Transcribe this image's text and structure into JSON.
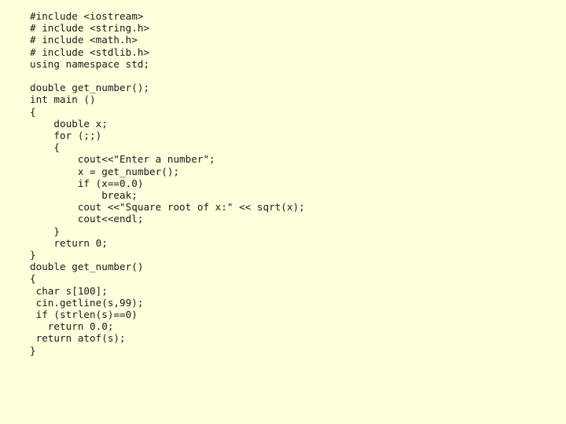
{
  "slide": {
    "background_color": "#ffffdc",
    "text_color": "#181818",
    "language": "cpp",
    "code_lines": [
      "#include <iostream>",
      "# include <string.h>",
      "# include <math.h>",
      "# include <stdlib.h>",
      "using namespace std;",
      "",
      "double get_number();",
      "int main ()",
      "{",
      "    double x;",
      "    for (;;)",
      "    {",
      "        cout<<\"Enter a number\";",
      "        x = get_number();",
      "        if (x==0.0)",
      "            break;",
      "        cout <<\"Square root of x:\" << sqrt(x);",
      "        cout<<endl;",
      "    }",
      "    return 0;",
      "}",
      "double get_number()",
      "{",
      " char s[100];",
      " cin.getline(s,99);",
      " if (strlen(s)==0)",
      "   return 0.0;",
      " return atof(s);",
      "}"
    ]
  }
}
